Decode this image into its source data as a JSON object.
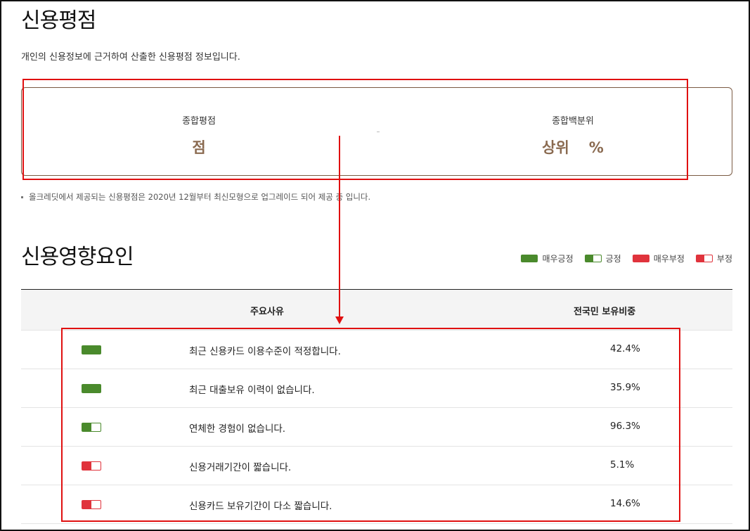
{
  "page": {
    "title": "신용평점",
    "description": "개인의 신용정보에 근거하여 산출한 신용평점 정보입니다."
  },
  "score_summary": {
    "total_score_label": "종합평점",
    "total_score_value": "",
    "total_score_unit": "점",
    "percentile_label": "종합백분위",
    "percentile_prefix": "상위",
    "percentile_value": "",
    "percentile_unit": "%"
  },
  "note": "올크레딧에서 제공되는 신용평점은 2020년 12월부터 최신모형으로 업그레이드 되어 제공 중 입니다.",
  "factors": {
    "title": "신용영향요인",
    "legend": [
      {
        "key": "very-positive",
        "label": "매우긍정",
        "color": "#4a8a2c"
      },
      {
        "key": "positive",
        "label": "긍정",
        "color": "#4a8a2c"
      },
      {
        "key": "very-negative",
        "label": "매우부정",
        "color": "#e0333c"
      },
      {
        "key": "negative",
        "label": "부정",
        "color": "#e0333c"
      }
    ],
    "columns": {
      "reason": "주요사유",
      "share": "전국민 보유비중"
    },
    "rows": [
      {
        "impact": "very-positive",
        "reason": "최근 신용카드 이용수준이 적정합니다.",
        "share": "42.4%"
      },
      {
        "impact": "very-positive",
        "reason": "최근 대출보유 이력이 없습니다.",
        "share": "35.9%"
      },
      {
        "impact": "positive",
        "reason": "연체한 경험이 없습니다.",
        "share": "96.3%"
      },
      {
        "impact": "negative",
        "reason": "신용거래기간이 짧습니다.",
        "share": "5.1%"
      },
      {
        "impact": "negative",
        "reason": "신용카드 보유기간이 다소 짧습니다.",
        "share": "14.6%"
      }
    ]
  },
  "colors": {
    "annotation_red": "#e01010",
    "score_brown": "#8a6a50",
    "box_border": "#7a5a43"
  }
}
